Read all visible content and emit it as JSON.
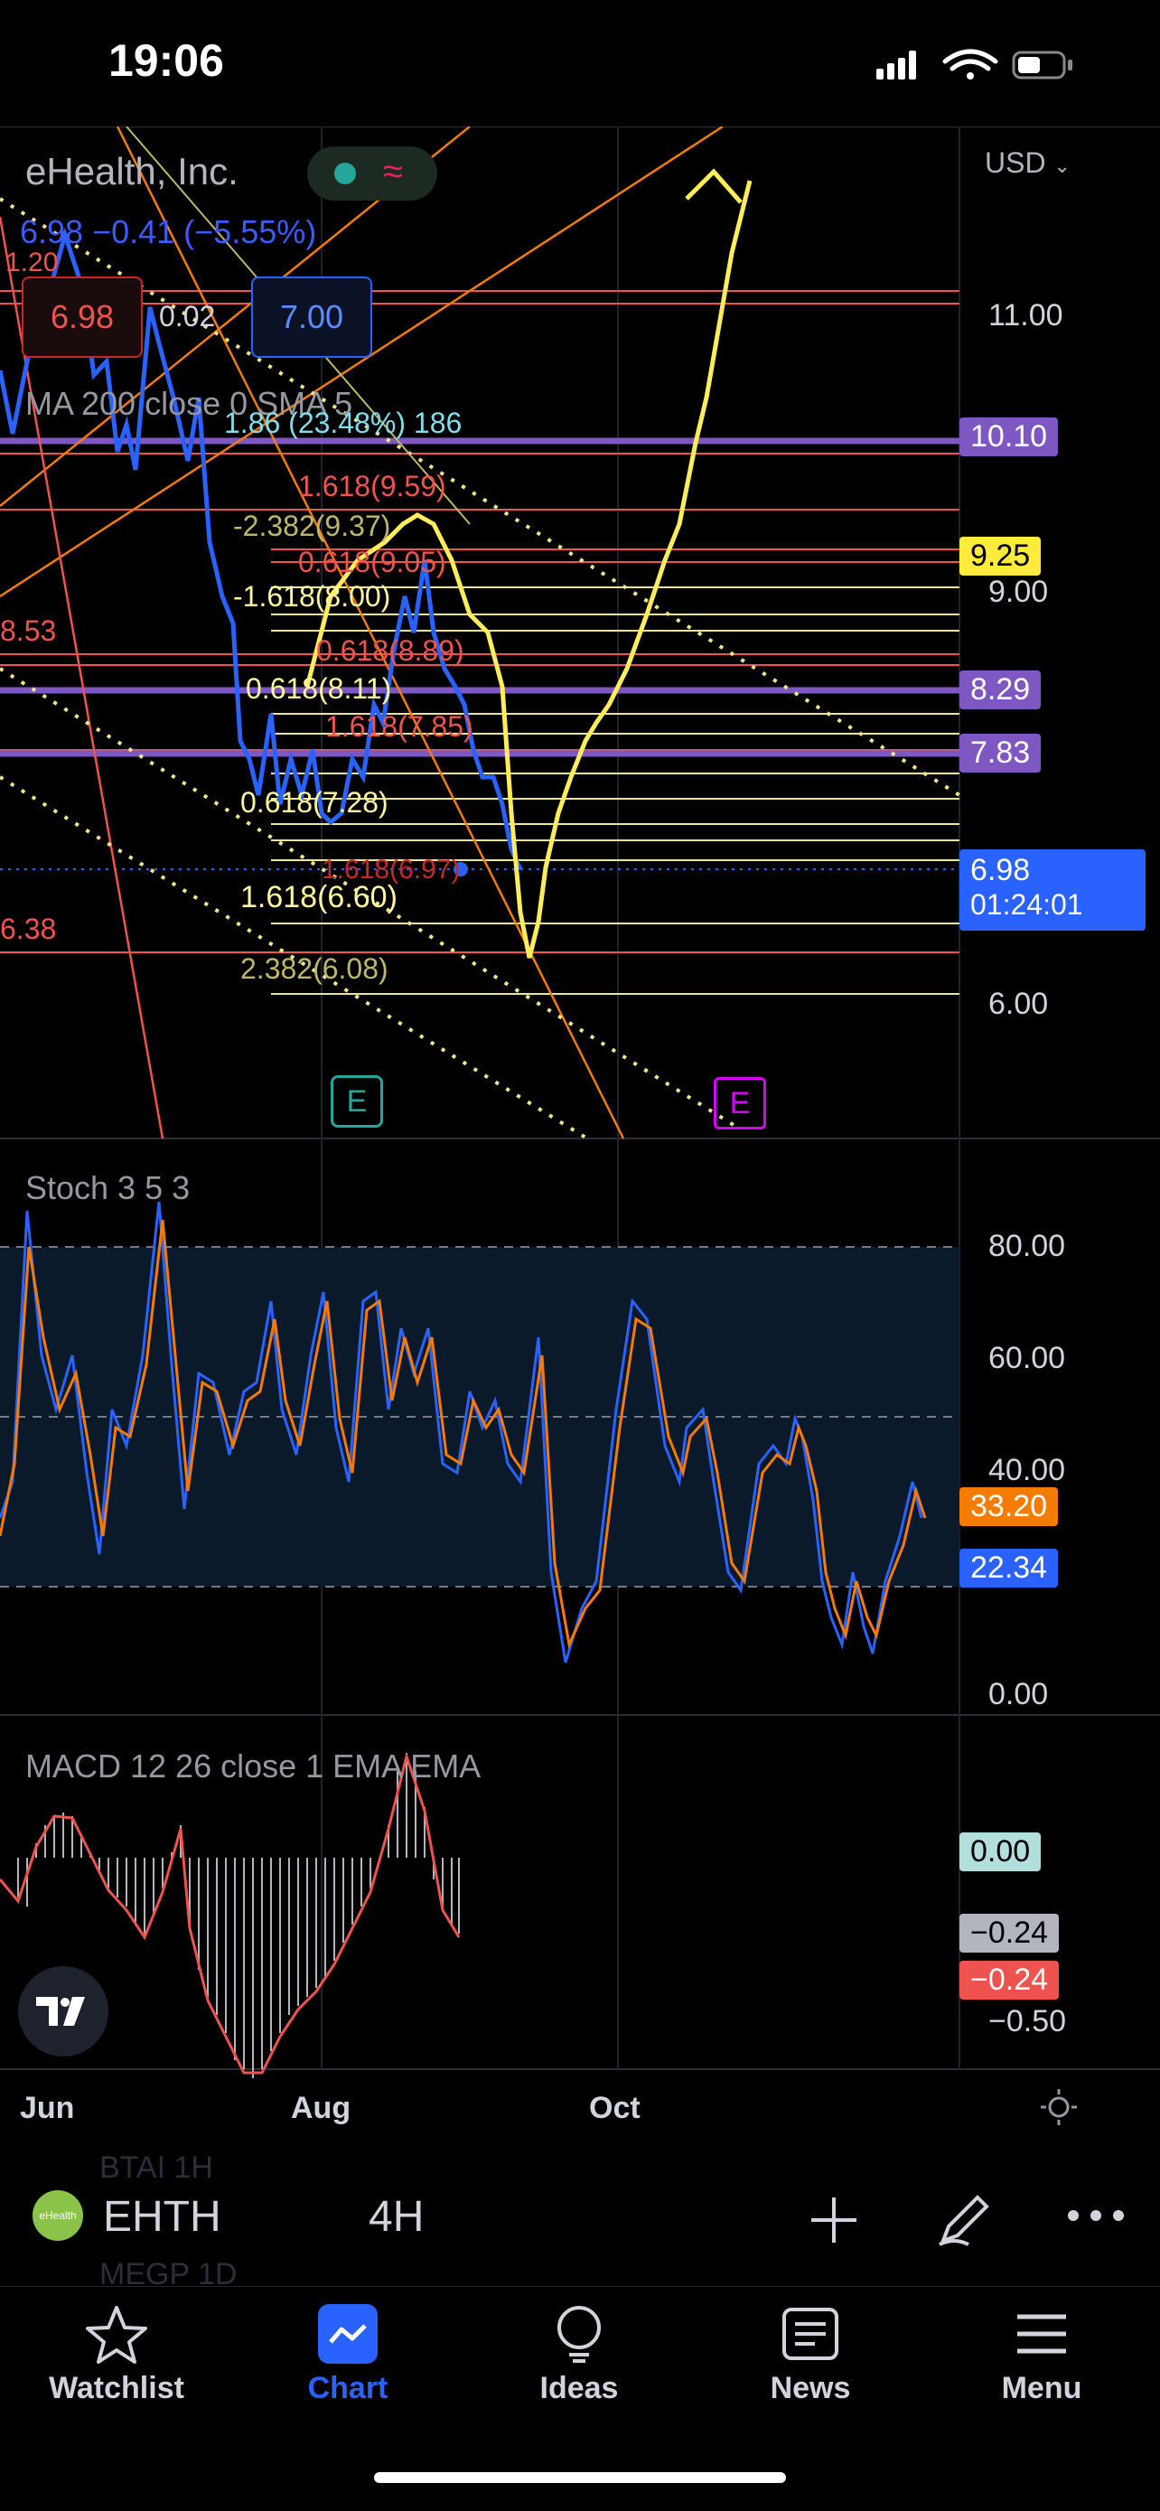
{
  "status": {
    "time": "19:06"
  },
  "header": {
    "company": "eHealth, Inc.",
    "price_change": "6.98 −0.41 (−5.55%)",
    "bid": "6.98",
    "spread": "0.02",
    "ask": "7.00",
    "currency": "USD"
  },
  "indicators": {
    "ma": "MA  200 close 0 SMA 5",
    "stoch": "Stoch  3 5 3",
    "macd": "MACD  12 26 close 1 EMA EMA"
  },
  "fib_labels": {
    "l1": "1.86 (23.48%) 186",
    "l2": "1.618(9.59)",
    "l3": "-2.382(9.37)",
    "l4": "0.618(9.05)",
    "l5": "-1.618(8.00)",
    "l6": "0.618(8.89)",
    "l7": "0.618(8.11)",
    "l8": "1.618(7.85)",
    "l9": "0.618(7.28)",
    "l10": "1.618(6.60)",
    "l11": "2.382(6.08)",
    "l12": "1.20",
    "l13": "8.53",
    "l14": "6.38",
    "l15": "1.618(6.97)"
  },
  "price_axis": {
    "labels": [
      "11.00",
      "9.00",
      "6.00"
    ],
    "tags": {
      "t1010": "10.10",
      "t925": "9.25",
      "t829": "8.29",
      "t783": "7.83",
      "current_price": "6.98",
      "countdown": "01:24:01"
    }
  },
  "stoch_axis": {
    "labels": [
      "80.00",
      "60.00",
      "40.00",
      "0.00"
    ],
    "tag_orange": "33.20",
    "tag_blue": "22.34"
  },
  "macd_axis": {
    "tag_zero": "0.00",
    "tag_gray": "−0.24",
    "tag_red": "−0.24",
    "label_neg": "−0.50"
  },
  "time_axis": {
    "labels": [
      "Jun",
      "Aug",
      "Oct"
    ]
  },
  "earnings": {
    "marker": "E"
  },
  "toolbar": {
    "symbol": "EHTH",
    "interval": "4H",
    "logo_text": "eHealth",
    "ghost_top": "BTAI     1H",
    "ghost_bottom": "MEGP    1D"
  },
  "tabs": {
    "watchlist": "Watchlist",
    "chart": "Chart",
    "ideas": "Ideas",
    "news": "News",
    "menu": "Menu"
  },
  "colors": {
    "accent": "#2962ff",
    "yellow": "#ffeb3b",
    "orange": "#f57c00",
    "purple": "#7e57c2",
    "red": "#ef5350",
    "blue": "#2962ff"
  }
}
